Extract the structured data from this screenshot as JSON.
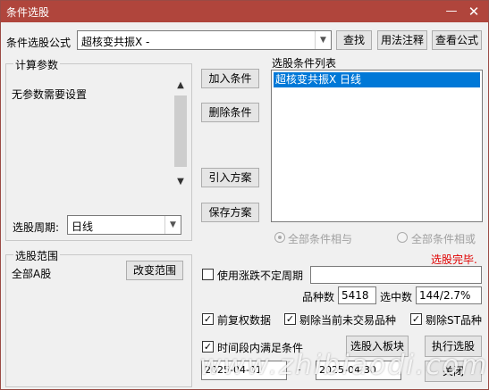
{
  "window": {
    "title": "条件选股",
    "min_symbol": "—",
    "close_symbol": "✕"
  },
  "formula": {
    "label": "条件选股公式",
    "value": "超核变共振X  -",
    "find_button": "查找",
    "usage_button": "用法注释",
    "view_button": "查看公式"
  },
  "params": {
    "group_label": "计算参数",
    "message": "无参数需要设置",
    "period_label": "选股周期:",
    "period_value": "日线"
  },
  "actions": {
    "add": "加入条件",
    "delete": "删除条件",
    "import": "引入方案",
    "save": "保存方案"
  },
  "conditions": {
    "list_label": "选股条件列表",
    "items": [
      "超核变共振X  日线"
    ],
    "radio_and": "全部条件相与",
    "radio_or": "全部条件相或",
    "status": "选股完毕.",
    "status_color": "#e00000"
  },
  "scope": {
    "group_label": "选股范围",
    "value": "全部A股",
    "change_button": "改变范围"
  },
  "options": {
    "use_indeterminate_label": "使用涨跌不定周期",
    "use_indeterminate_checked": "",
    "count_label": "品种数",
    "count_value": "5418",
    "selected_label": "选中数",
    "selected_value": "144/2.7%",
    "forward_adj_label": "前复权数据",
    "forward_adj_checked": "✓",
    "exclude_nontrading_label": "剔除当前未交易品种",
    "exclude_nontrading_checked": "✓",
    "exclude_st_label": "剔除ST品种",
    "exclude_st_checked": "✓",
    "time_range_label": "时间段内满足条件",
    "time_range_checked": "✓",
    "start_date": "2025-04-01",
    "end_date": "2025-04-30",
    "date_sep": "-",
    "to_block_button": "选股入板块",
    "execute_button": "执行选股",
    "close_button": "关闭"
  },
  "watermark": "www.zhibiaodi.com",
  "icons": {
    "dropdown": "chevron-down-icon",
    "scroll_up": "chevron-up-icon",
    "scroll_down": "chevron-down-icon",
    "check": "check-icon"
  }
}
